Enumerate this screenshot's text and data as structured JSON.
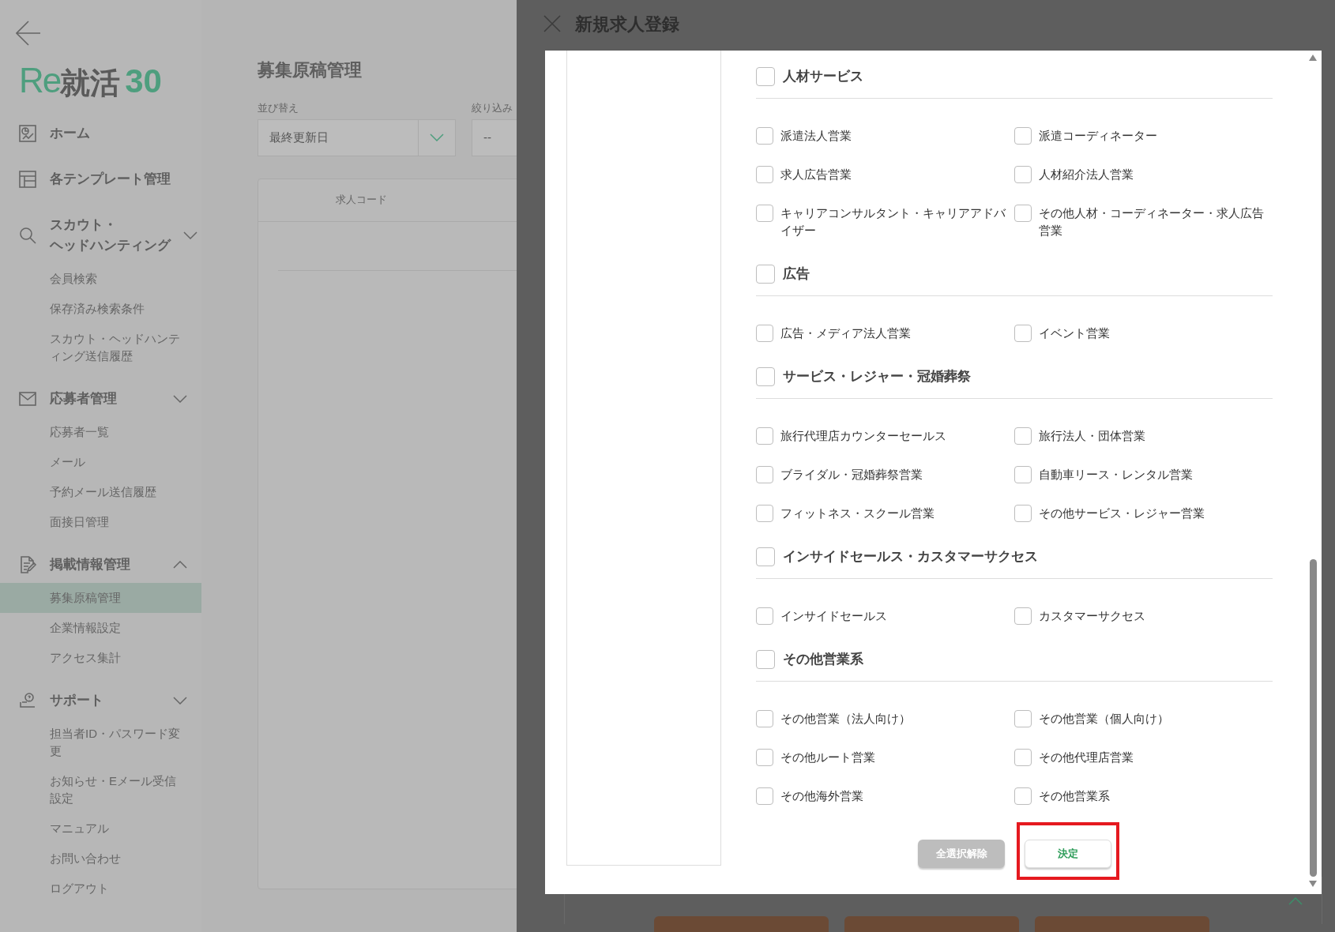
{
  "sidebar": {
    "logo": {
      "latin": "Re",
      "kanji": "就活",
      "number": "30"
    },
    "sections": [
      {
        "label": [
          "ホーム"
        ]
      },
      {
        "label": [
          "各テンプレート管理"
        ]
      },
      {
        "label": [
          "スカウト・",
          "ヘッドハンティング"
        ],
        "expanded": false,
        "items": [
          {
            "label": "会員検索",
            "selected": false
          },
          {
            "label": "保存済み検索条件",
            "selected": false
          },
          {
            "label": "スカウト・ヘッドハンティング送信履歴",
            "selected": false
          }
        ]
      },
      {
        "label": [
          "応募者管理"
        ],
        "expanded": false,
        "items": [
          {
            "label": "応募者一覧",
            "selected": false
          },
          {
            "label": "メール",
            "selected": false
          },
          {
            "label": "予約メール送信履歴",
            "selected": false
          },
          {
            "label": "面接日管理",
            "selected": false
          }
        ]
      },
      {
        "label": [
          "掲載情報管理"
        ],
        "expanded": true,
        "items": [
          {
            "label": "募集原稿管理",
            "selected": true
          },
          {
            "label": "企業情報設定",
            "selected": false
          },
          {
            "label": "アクセス集計",
            "selected": false
          }
        ]
      },
      {
        "label": [
          "サポート"
        ],
        "expanded": false,
        "items": [
          {
            "label": "担当者ID・パスワード変更",
            "selected": false
          },
          {
            "label": "お知らせ・Eメール受信設定",
            "selected": false
          },
          {
            "label": "マニュアル",
            "selected": false
          },
          {
            "label": "お問い合わせ",
            "selected": false
          },
          {
            "label": "ログアウト",
            "selected": false
          }
        ]
      }
    ]
  },
  "main": {
    "title": "募集原稿管理",
    "sort": {
      "label": "並び替え",
      "value": "最終更新日"
    },
    "filter": {
      "label": "絞り込み",
      "value": "--"
    },
    "table": {
      "columns": [
        "求人コード"
      ]
    }
  },
  "drawer": {
    "title": "新規求人登録",
    "modal": {
      "groups": [
        {
          "label": "人材サービス",
          "checked": false,
          "options": [
            {
              "label": "派遣法人営業",
              "checked": false
            },
            {
              "label": "派遣コーディネーター",
              "checked": false
            },
            {
              "label": "求人広告営業",
              "checked": false
            },
            {
              "label": "人材紹介法人営業",
              "checked": false
            },
            {
              "label": "キャリアコンサルタント・キャリアアドバイザー",
              "checked": false
            },
            {
              "label": "その他人材・コーディネーター・求人広告営業",
              "checked": false
            }
          ]
        },
        {
          "label": "広告",
          "checked": false,
          "options": [
            {
              "label": "広告・メディア法人営業",
              "checked": false
            },
            {
              "label": "イベント営業",
              "checked": false
            }
          ]
        },
        {
          "label": "サービス・レジャー・冠婚葬祭",
          "checked": false,
          "options": [
            {
              "label": "旅行代理店カウンターセールス",
              "checked": false
            },
            {
              "label": "旅行法人・団体営業",
              "checked": false
            },
            {
              "label": "ブライダル・冠婚葬祭営業",
              "checked": false
            },
            {
              "label": "自動車リース・レンタル営業",
              "checked": false
            },
            {
              "label": "フィットネス・スクール営業",
              "checked": false
            },
            {
              "label": "その他サービス・レジャー営業",
              "checked": false
            }
          ]
        },
        {
          "label": "インサイドセールス・カスタマーサクセス",
          "checked": false,
          "options": [
            {
              "label": "インサイドセールス",
              "checked": false
            },
            {
              "label": "カスタマーサクセス",
              "checked": false
            }
          ]
        },
        {
          "label": "その他営業系",
          "checked": false,
          "options": [
            {
              "label": "その他営業（法人向け）",
              "checked": false
            },
            {
              "label": "その他営業（個人向け）",
              "checked": false
            },
            {
              "label": "その他ルート営業",
              "checked": false
            },
            {
              "label": "その他代理店営業",
              "checked": false
            },
            {
              "label": "その他海外営業",
              "checked": false
            },
            {
              "label": "その他営業系",
              "checked": false
            }
          ]
        }
      ],
      "buttons": [
        {
          "label": "全選択解除",
          "kind": "secondary"
        },
        {
          "label": "決定",
          "kind": "primary",
          "highlighted": true
        }
      ]
    }
  }
}
